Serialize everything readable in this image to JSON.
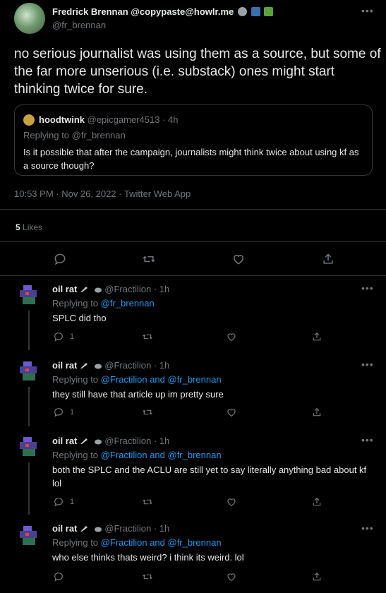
{
  "main_tweet": {
    "name": "Fredrick Brennan @copypaste@howlr.me",
    "handle": "@fr_brennan",
    "text": "no serious journalist was using them as a source, but some of the far more unserious (i.e. substack) ones might start thinking twice for sure.",
    "quote": {
      "name": "hoodtwink",
      "handle_time": "@epicgamer4513 · 4h",
      "replying_prefix": "Replying to ",
      "replying_to": "@fr_brennan",
      "text": "Is it possible that after the campaign, journalists might think twice about using kf as a source though?"
    },
    "timestamp": "10:53 PM · Nov 26, 2022 · Twitter Web App",
    "likes_count": "5",
    "likes_label": "Likes"
  },
  "replies": [
    {
      "name": "oil rat",
      "handle_time": "@Fractilion · 1h",
      "replying_prefix": "Replying to ",
      "replying_to": "@fr_brennan",
      "text": "SPLC did tho",
      "reply_count": "1"
    },
    {
      "name": "oil rat",
      "handle_time": "@Fractilion · 1h",
      "replying_prefix": "Replying to ",
      "replying_to": "@Fractilion and @fr_brennan",
      "text": "they still have that article up im pretty sure",
      "reply_count": "1"
    },
    {
      "name": "oil rat",
      "handle_time": "@Fractilion · 1h",
      "replying_prefix": "Replying to ",
      "replying_to": "@Fractilion and @fr_brennan",
      "text": "both the SPLC and the ACLU are still yet to say literally anything bad about kf lol",
      "reply_count": "1"
    },
    {
      "name": "oil rat",
      "handle_time": "@Fractilion · 1h",
      "replying_prefix": "Replying to ",
      "replying_to": "@Fractilion and @fr_brennan",
      "text": "who else thinks thats weird? i think its weird. lol",
      "reply_count": ""
    }
  ],
  "colors": {
    "background": "#000000",
    "text": "#e7e9ea",
    "muted": "#71767b",
    "link": "#1d9bf0",
    "divider": "#2f3336"
  },
  "icons": [
    "more-icon",
    "reply-icon",
    "retweet-icon",
    "like-icon",
    "share-icon"
  ]
}
